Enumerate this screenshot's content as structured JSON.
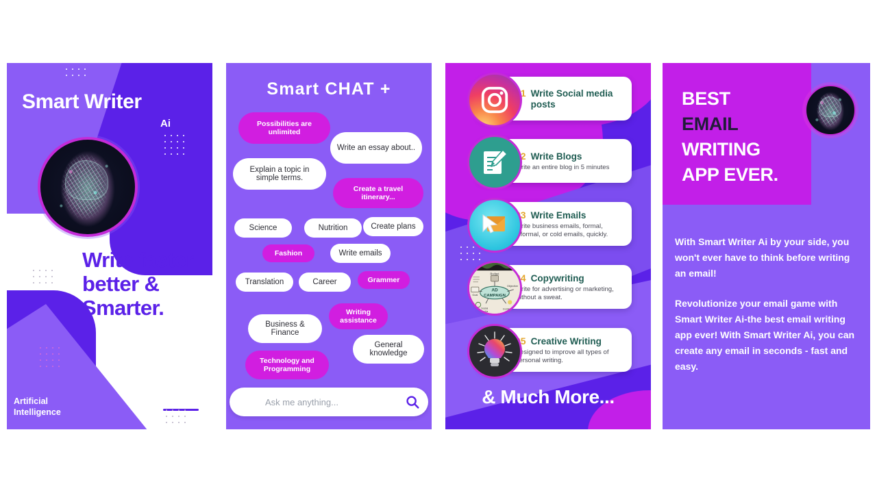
{
  "panel1": {
    "title": "Smart Writer",
    "ai_mark": "Ai",
    "headline": "Write faster better & Smarter.",
    "footer_label": "Artificial Intelligence",
    "colors": {
      "light_purple": "#8B5CF6",
      "dark_violet": "#5B21E8",
      "magenta": "#C42BD8"
    }
  },
  "panel2": {
    "title": "Smart CHAT +",
    "pills": [
      {
        "label": "Possibilities are unlimited",
        "style": "pink"
      },
      {
        "label": "Write an essay about..",
        "style": "white"
      },
      {
        "label": "Explain a topic in simple terms.",
        "style": "white"
      },
      {
        "label": "Create a travel itinerary...",
        "style": "pink"
      },
      {
        "label": "Science",
        "style": "white"
      },
      {
        "label": "Nutrition",
        "style": "white"
      },
      {
        "label": "Create plans",
        "style": "white"
      },
      {
        "label": "Fashion",
        "style": "pink"
      },
      {
        "label": "Write emails",
        "style": "white"
      },
      {
        "label": "Translation",
        "style": "white"
      },
      {
        "label": "Career",
        "style": "white"
      },
      {
        "label": "Grammer",
        "style": "pink"
      },
      {
        "label": "Writing assistance",
        "style": "pink"
      },
      {
        "label": "Business & Finance",
        "style": "white"
      },
      {
        "label": "General knowledge",
        "style": "white"
      },
      {
        "label": "Technology and Programming",
        "style": "pink"
      }
    ],
    "search": {
      "placeholder": "Ask me anything...",
      "value": "",
      "icon": "search-icon"
    },
    "colors": {
      "background": "#8B5CF6",
      "pill_pink": "#D11EE0",
      "pill_white": "#FFFFFF"
    }
  },
  "panel3": {
    "items": [
      {
        "num": "01",
        "title": "Write Social media posts",
        "desc": "",
        "icon": "instagram-icon"
      },
      {
        "num": "02",
        "title": "Write Blogs",
        "desc": "Write an entire blog in 5 minutes",
        "icon": "notepad-pencil-icon"
      },
      {
        "num": "03",
        "title": "Write Emails",
        "desc": "Write business emails, formal, informal, or cold emails, quickly.",
        "icon": "envelope-cursor-icon"
      },
      {
        "num": "04",
        "title": "Copywriting",
        "desc": "Write for advertising or marketing, without a sweat.",
        "icon": "ad-campaign-mindmap-icon"
      },
      {
        "num": "05",
        "title": "Creative Writing",
        "desc": "Designed to improve all types of personal writing.",
        "icon": "lightbulb-icon"
      }
    ],
    "footer": "& Much More...",
    "mindmap_labels": {
      "center": "AD CAMPAIGN",
      "budget": "Budget",
      "objective": "Objective",
      "social": "Social Media",
      "content": "Content"
    },
    "colors": {
      "background": "#5B21E8",
      "magenta": "#C21FE8",
      "number": "#E3A62C",
      "title": "#1F5C52"
    }
  },
  "panel4": {
    "heading_line1": "BEST",
    "heading_line2": "EMAIL",
    "heading_line3": "WRITING",
    "heading_line4": "APP EVER.",
    "paragraph1": "With Smart Writer Ai by your side, you won't ever have to think before writing an email!",
    "paragraph2": "Revolutionize your email game with Smart Writer Ai-the best email writing app ever! With Smart Writer Ai, you can create any email in seconds - fast and easy.",
    "colors": {
      "background": "#8B5CF6",
      "magenta": "#C21FE8",
      "dark_word": "#221B3A"
    }
  }
}
